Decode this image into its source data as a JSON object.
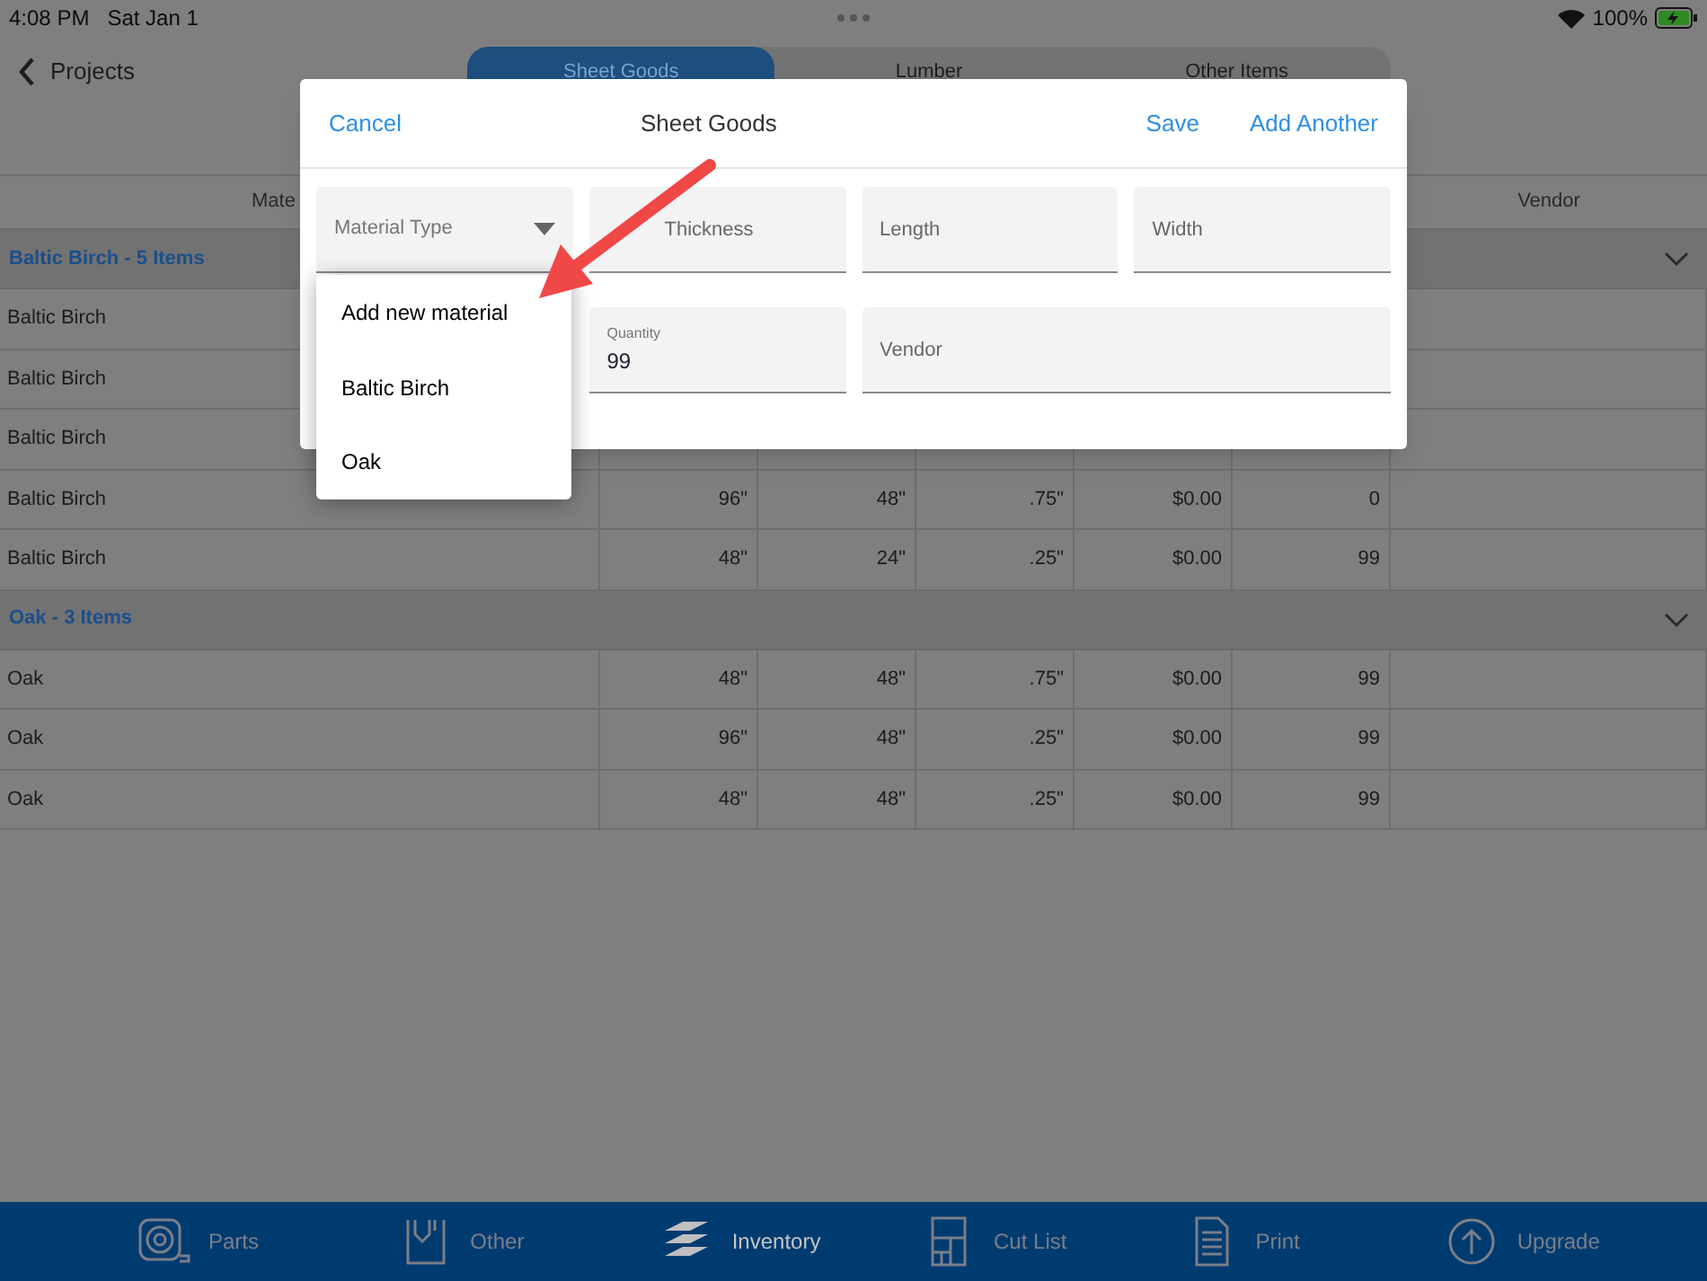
{
  "status_bar": {
    "time": "4:08 PM",
    "date": "Sat Jan 1",
    "battery": "100%"
  },
  "nav": {
    "back": "Projects",
    "segments": [
      {
        "label": "Sheet Goods",
        "selected": true
      },
      {
        "label": "Lumber",
        "selected": false
      },
      {
        "label": "Other Items",
        "selected": false
      }
    ]
  },
  "table": {
    "column_1": "Mate",
    "column_7": "Vendor",
    "groups": [
      {
        "title": "Baltic Birch - 5 Items",
        "expanded": true,
        "rows": [
          {
            "cells": [
              "Baltic Birch"
            ]
          },
          {
            "cells": [
              "Baltic Birch"
            ]
          },
          {
            "cells": [
              "Baltic Birch"
            ]
          },
          {
            "cells": [
              "Baltic Birch",
              "96\"",
              "48\"",
              ".75\"",
              "$0.00",
              "0"
            ]
          },
          {
            "cells": [
              "Baltic Birch",
              "48\"",
              "24\"",
              ".25\"",
              "$0.00",
              "99"
            ]
          }
        ]
      },
      {
        "title": "Oak - 3 Items",
        "expanded": true,
        "rows": [
          {
            "cells": [
              "Oak",
              "48\"",
              "48\"",
              ".75\"",
              "$0.00",
              "99"
            ]
          },
          {
            "cells": [
              "Oak",
              "96\"",
              "48\"",
              ".25\"",
              "$0.00",
              "99"
            ]
          },
          {
            "cells": [
              "Oak",
              "48\"",
              "48\"",
              ".25\"",
              "$0.00",
              "99"
            ]
          }
        ]
      }
    ]
  },
  "modal": {
    "cancel": "Cancel",
    "title": "Sheet Goods",
    "save": "Save",
    "add_another": "Add Another",
    "fields": [
      {
        "kind": "select",
        "placeholder": "Material Type"
      },
      {
        "kind": "text",
        "placeholder": "Thickness"
      },
      {
        "kind": "text",
        "placeholder": "Length"
      },
      {
        "kind": "text",
        "placeholder": "Width"
      },
      {
        "kind": "hidden"
      },
      {
        "kind": "text",
        "label": "Quantity",
        "value": "99"
      },
      {
        "kind": "text",
        "placeholder": "Vendor",
        "wide": true
      }
    ],
    "dropdown": [
      "Add new material",
      "Baltic Birch",
      "Oak"
    ]
  },
  "tab_bar": [
    {
      "kind": "tape",
      "label": "Parts",
      "selected": false
    },
    {
      "kind": "other",
      "label": "Other",
      "selected": false
    },
    {
      "kind": "layers",
      "label": "Inventory",
      "selected": true
    },
    {
      "kind": "cutlist",
      "label": "Cut List",
      "selected": false
    },
    {
      "kind": "print",
      "label": "Print",
      "selected": false
    },
    {
      "kind": "upgrade",
      "label": "Upgrade",
      "selected": false
    }
  ]
}
